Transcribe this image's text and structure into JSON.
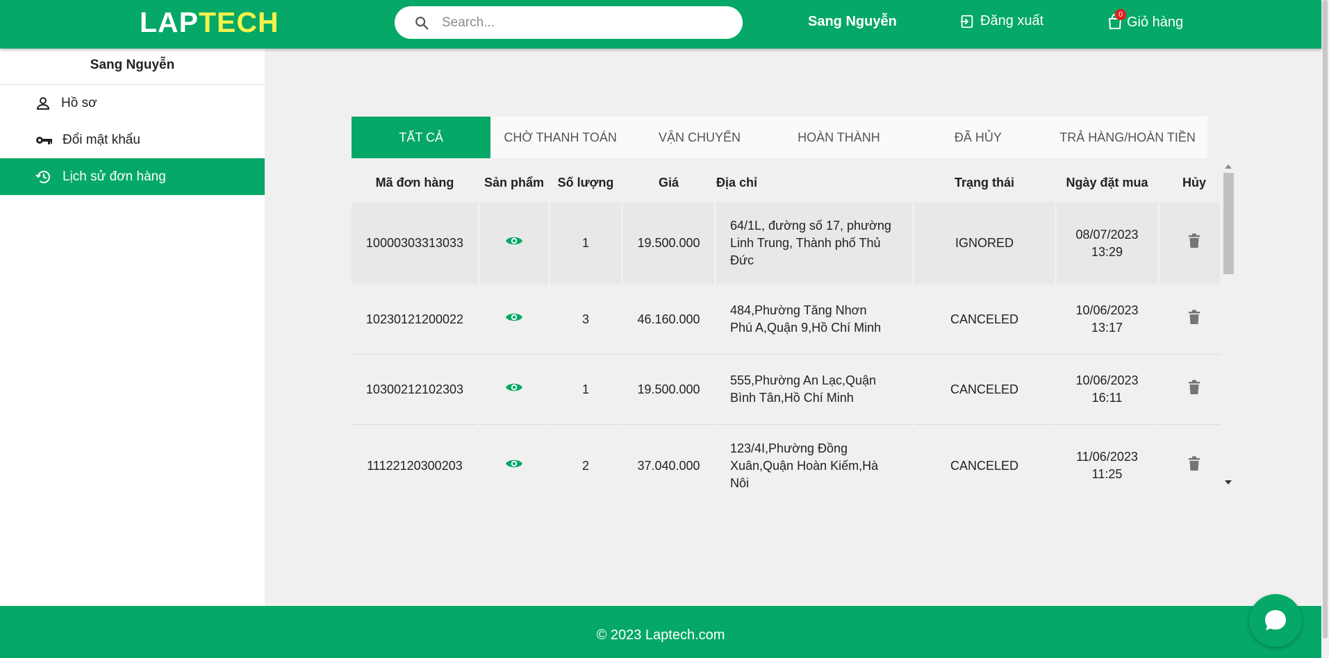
{
  "header": {
    "logo_part1": "LAP",
    "logo_part2": "TECH",
    "search_placeholder": "Search...",
    "user_name": "Sang Nguyễn",
    "logout_label": "Đăng xuất",
    "cart_label": "Giỏ hàng",
    "cart_count": "0"
  },
  "sidebar": {
    "user_name": "Sang Nguyễn",
    "items": [
      {
        "label": "Hồ sơ",
        "icon": "person-icon"
      },
      {
        "label": "Đổi mật khẩu",
        "icon": "key-icon"
      },
      {
        "label": "Lịch sử đơn hàng",
        "icon": "history-icon",
        "active": true
      }
    ]
  },
  "tabs": [
    {
      "label": "TẤT CẢ",
      "active": true
    },
    {
      "label": "CHỜ THANH TOÁN"
    },
    {
      "label": "VẬN CHUYỂN"
    },
    {
      "label": "HOÀN THÀNH"
    },
    {
      "label": "ĐÃ HỦY"
    },
    {
      "label": "TRẢ HÀNG/HOÀN TIỀN"
    }
  ],
  "table": {
    "headers": {
      "order_id": "Mã đơn hàng",
      "product": "Sản phẩm",
      "quantity": "Số lượng",
      "price": "Giá",
      "address": "Địa chỉ",
      "status": "Trạng thái",
      "date": "Ngày đặt mua",
      "cancel": "Hủy"
    },
    "rows": [
      {
        "order_id": "10000303313033",
        "quantity": "1",
        "price": "19.500.000",
        "address": "64/1L, đường số 17, phường Linh Trung, Thành phố Thủ Đức",
        "status": "IGNORED",
        "date": "08/07/2023",
        "time": "13:29"
      },
      {
        "order_id": "10230121200022",
        "quantity": "3",
        "price": "46.160.000",
        "address": "484,Phường Tăng Nhơn Phú A,Quận 9,Hồ Chí Minh",
        "status": "CANCELED",
        "date": "10/06/2023",
        "time": "13:17"
      },
      {
        "order_id": "10300212102303",
        "quantity": "1",
        "price": "19.500.000",
        "address": "555,Phường An Lạc,Quận Bình Tân,Hồ Chí Minh",
        "status": "CANCELED",
        "date": "10/06/2023",
        "time": "16:11"
      },
      {
        "order_id": "11122120300203",
        "quantity": "2",
        "price": "37.040.000",
        "address": "123/4I,Phường Đồng Xuân,Quận Hoàn Kiếm,Hà Nội",
        "status": "CANCELED",
        "date": "11/06/2023",
        "time": "11:25"
      }
    ]
  },
  "footer": {
    "copyright": "© 2023 Laptech.com"
  },
  "colors": {
    "brand_green": "#05a866",
    "logo_yellow": "#f2f24a",
    "badge_red": "#e31c1c"
  }
}
